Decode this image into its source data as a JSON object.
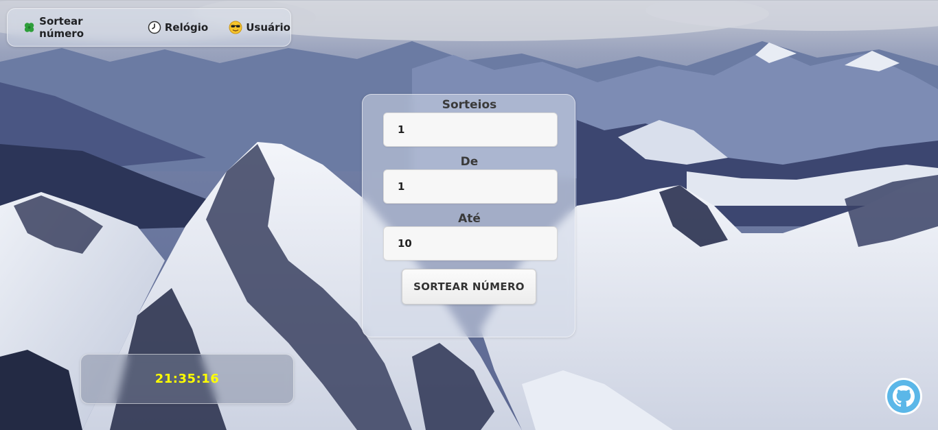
{
  "nav": {
    "items": [
      {
        "label": "Sortear número",
        "icon": "clover-icon"
      },
      {
        "label": "Relógio",
        "icon": "clock-icon"
      },
      {
        "label": "Usuário",
        "icon": "cool-face-icon"
      }
    ]
  },
  "form": {
    "sorteios_label": "Sorteios",
    "sorteios_value": "1",
    "de_label": "De",
    "de_value": "1",
    "ate_label": "Até",
    "ate_value": "10",
    "button_label": "SORTEAR NÚMERO"
  },
  "clock": {
    "time": "21:35:16",
    "color": "#ffff00"
  },
  "github": {
    "icon": "github-icon",
    "color": "#5bb7e8"
  }
}
